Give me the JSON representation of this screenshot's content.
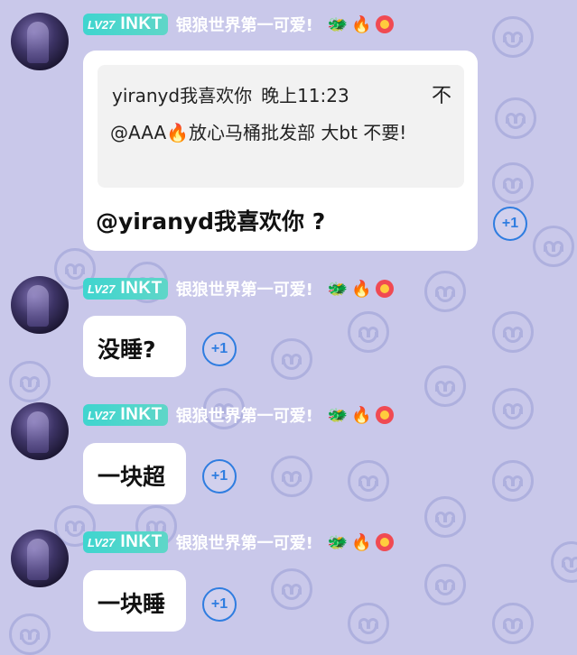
{
  "user": {
    "level_label": "LV27",
    "tag": "INKT",
    "name": "银狼世界第一可爱!"
  },
  "badges": [
    "dragon-icon",
    "fire-icon",
    "flower-icon"
  ],
  "badge_glyphs": {
    "dragon": "🐲",
    "fire": "🔥"
  },
  "plus_one_label": "+1",
  "messages": [
    {
      "quote": {
        "author": "yiranyd我喜欢你",
        "time": "晚上11:23",
        "pin": "不",
        "text": "@AAA🔥放心马桶批发部 大bt 不要!"
      },
      "text": "@yiranyd我喜欢你 ?"
    },
    {
      "text": "没睡?"
    },
    {
      "text": "一块超"
    },
    {
      "text": "一块睡"
    }
  ],
  "colors": {
    "background": "#c9c8ea",
    "level_tag": "#3fd5cf",
    "plus_one": "#2f7de0"
  }
}
